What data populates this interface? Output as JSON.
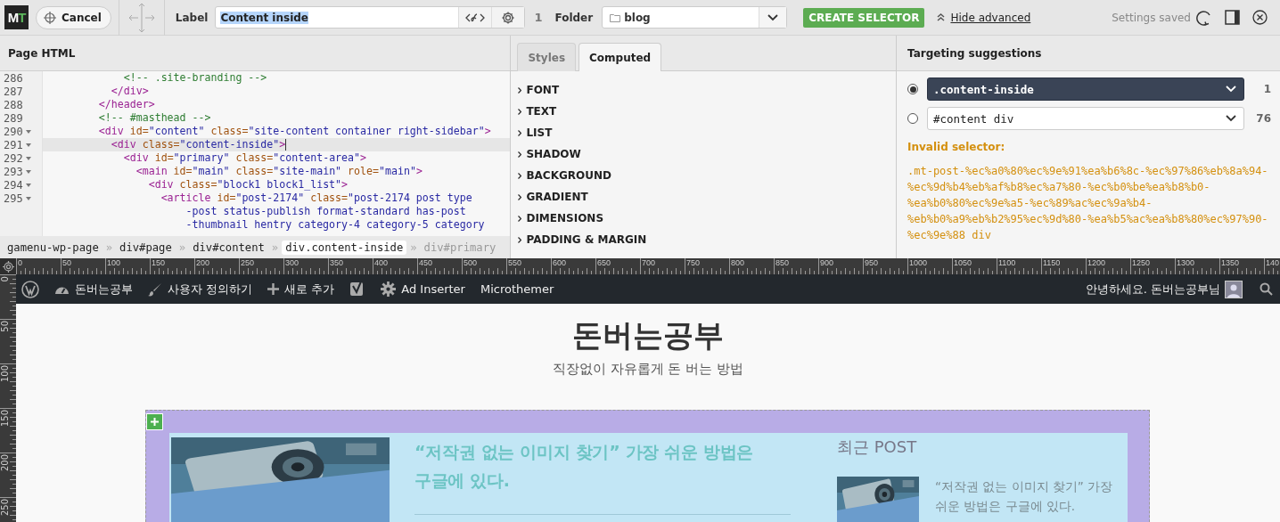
{
  "toolbar": {
    "logo": "MT",
    "cancel": "Cancel",
    "label_caption": "Label",
    "label_value": "Content inside",
    "match_count": "1",
    "folder_caption": "Folder",
    "folder_value": "blog",
    "create_button": "CREATE SELECTOR",
    "advanced_link": "Hide advanced",
    "status": "Settings saved"
  },
  "html_panel": {
    "title": "Page HTML",
    "lines": [
      {
        "number": "286",
        "foldable": false,
        "active": false,
        "tokens": [
          {
            "kind": "comment",
            "text": "            <!-- .site-branding -->"
          }
        ]
      },
      {
        "number": "287",
        "foldable": false,
        "active": false,
        "tokens": [
          {
            "kind": "tag",
            "text": "          </div>"
          }
        ]
      },
      {
        "number": "288",
        "foldable": false,
        "active": false,
        "tokens": [
          {
            "kind": "tag",
            "text": "        </header>"
          }
        ]
      },
      {
        "number": "289",
        "foldable": false,
        "active": false,
        "tokens": [
          {
            "kind": "comment",
            "text": "        <!-- #masthead -->"
          }
        ]
      },
      {
        "number": "290",
        "foldable": true,
        "active": false,
        "tokens": [
          {
            "kind": "tag",
            "text": "        <div"
          },
          {
            "kind": "attr",
            "text": " id="
          },
          {
            "kind": "value",
            "text": "\"content\""
          },
          {
            "kind": "attr",
            "text": " class="
          },
          {
            "kind": "value",
            "text": "\"site-content container right-sidebar\""
          },
          {
            "kind": "tag",
            "text": ">"
          }
        ]
      },
      {
        "number": "291",
        "foldable": true,
        "active": true,
        "tokens": [
          {
            "kind": "tag",
            "text": "          <div"
          },
          {
            "kind": "attr",
            "text": " class="
          },
          {
            "kind": "value",
            "text": "\"content-inside\""
          },
          {
            "kind": "tag",
            "text": ">"
          }
        ]
      },
      {
        "number": "292",
        "foldable": true,
        "active": false,
        "tokens": [
          {
            "kind": "tag",
            "text": "            <div"
          },
          {
            "kind": "attr",
            "text": " id="
          },
          {
            "kind": "value",
            "text": "\"primary\""
          },
          {
            "kind": "attr",
            "text": " class="
          },
          {
            "kind": "value",
            "text": "\"content-area\""
          },
          {
            "kind": "tag",
            "text": ">"
          }
        ]
      },
      {
        "number": "293",
        "foldable": true,
        "active": false,
        "tokens": [
          {
            "kind": "tag",
            "text": "              <main"
          },
          {
            "kind": "attr",
            "text": " id="
          },
          {
            "kind": "value",
            "text": "\"main\""
          },
          {
            "kind": "attr",
            "text": " class="
          },
          {
            "kind": "value",
            "text": "\"site-main\""
          },
          {
            "kind": "attr",
            "text": " role="
          },
          {
            "kind": "value",
            "text": "\"main\""
          },
          {
            "kind": "tag",
            "text": ">"
          }
        ]
      },
      {
        "number": "294",
        "foldable": true,
        "active": false,
        "tokens": [
          {
            "kind": "tag",
            "text": "                <div"
          },
          {
            "kind": "attr",
            "text": " class="
          },
          {
            "kind": "value",
            "text": "\"block1 block1_list\""
          },
          {
            "kind": "tag",
            "text": ">"
          }
        ]
      },
      {
        "number": "295",
        "foldable": true,
        "active": false,
        "tokens": [
          {
            "kind": "tag",
            "text": "                  <article"
          },
          {
            "kind": "attr",
            "text": " id="
          },
          {
            "kind": "value",
            "text": "\"post-2174\""
          },
          {
            "kind": "attr",
            "text": " class="
          },
          {
            "kind": "value",
            "text": "\"post-2174 post type"
          }
        ],
        "wrapped": [
          "-post status-publish format-standard has-post",
          "-thumbnail hentry category-4 category-5 category"
        ]
      }
    ],
    "breadcrumb": {
      "separator": "»",
      "items": [
        {
          "text": "gamenu-wp-page",
          "selected": false,
          "dimmed": false
        },
        {
          "text": "div#page",
          "selected": false,
          "dimmed": false
        },
        {
          "text": "div#content",
          "selected": false,
          "dimmed": false
        },
        {
          "text": "div.content-inside",
          "selected": true,
          "dimmed": false
        },
        {
          "text": "div#primary",
          "selected": false,
          "dimmed": true
        }
      ]
    }
  },
  "style_panel": {
    "tabs": [
      {
        "label": "Styles",
        "selected": false
      },
      {
        "label": "Computed",
        "selected": true
      }
    ],
    "sections": [
      "FONT",
      "TEXT",
      "LIST",
      "SHADOW",
      "BACKGROUND",
      "GRADIENT",
      "DIMENSIONS",
      "PADDING & MARGIN"
    ]
  },
  "targeting": {
    "title": "Targeting suggestions",
    "suggestions": [
      {
        "selector": ".content-inside",
        "count": "1",
        "selected": true
      },
      {
        "selector": "#content div",
        "count": "76",
        "selected": false
      }
    ],
    "error_label": "Invalid selector:",
    "error_text": ".mt-post-%ec%a0%80%ec%9e%91%ea%b6%8c-%ec%97%86%eb%8a%94-%ec%9d%b4%eb%af%b8%ec%a7%80-%ec%b0%be%ea%b8%b0-%ea%b0%80%ec%9e%a5-%ec%89%ac%ec%9a%b4-%eb%b0%a9%eb%b2%95%ec%9d%80-%ea%b5%ac%ea%b8%80%ec%97%90-%ec%9e%88 div"
  },
  "ruler": {
    "ticks": [
      "0",
      "50",
      "100",
      "150",
      "200",
      "250",
      "300",
      "350",
      "400",
      "450",
      "500",
      "550",
      "600",
      "650",
      "700",
      "750",
      "800",
      "850",
      "900",
      "950",
      "1000",
      "1050",
      "1100",
      "1150",
      "1200",
      "1250",
      "1300",
      "1350",
      "140"
    ],
    "vertical_ticks": [
      "0",
      "50",
      "100",
      "150",
      "200",
      "250"
    ]
  },
  "admin_bar": {
    "items": [
      {
        "kind": "wordpress"
      },
      {
        "kind": "dashboard",
        "label": "돈버는공부"
      },
      {
        "kind": "brush",
        "label": "사용자 정의하기"
      },
      {
        "kind": "plus",
        "label": "새로 추가"
      },
      {
        "kind": "yoast"
      },
      {
        "kind": "gear",
        "label": "Ad Inserter"
      },
      {
        "kind": "text",
        "label": "Microthemer"
      }
    ],
    "greeting": "안녕하세요. 돈버는공부님"
  },
  "site": {
    "title": "돈버는공부",
    "tagline": "직장없이 자유롭게 돈 버는 방법",
    "post_title": "“저작권 없는 이미지 찾기” 가장 쉬운 방법은 구글에 있다.",
    "sidebar_heading": "최근 POST",
    "recent_posts": [
      "“저작권 없는 이미지 찾기” 가장 쉬운 방법은 구글에 있다."
    ]
  }
}
